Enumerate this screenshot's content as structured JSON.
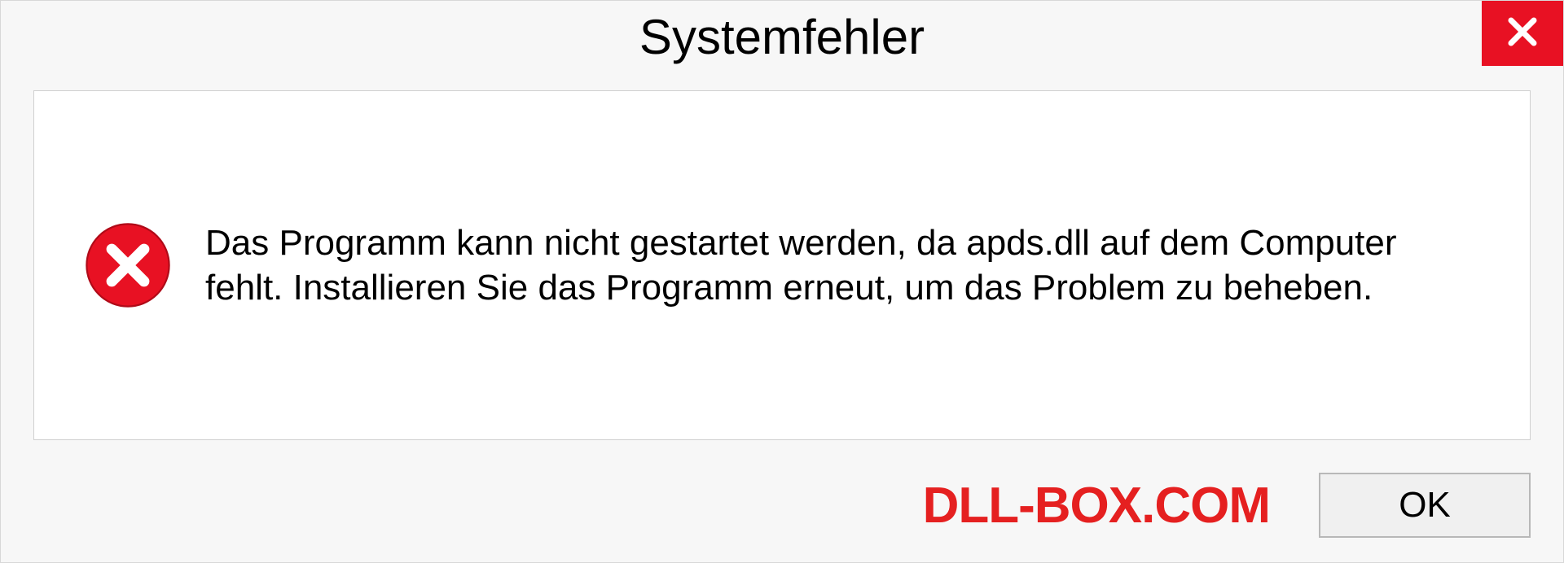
{
  "dialog": {
    "title": "Systemfehler",
    "message": "Das Programm kann nicht gestartet werden, da apds.dll auf dem Computer fehlt. Installieren Sie das Programm erneut, um das Problem zu beheben.",
    "ok_label": "OK"
  },
  "watermark": "DLL-BOX.COM"
}
